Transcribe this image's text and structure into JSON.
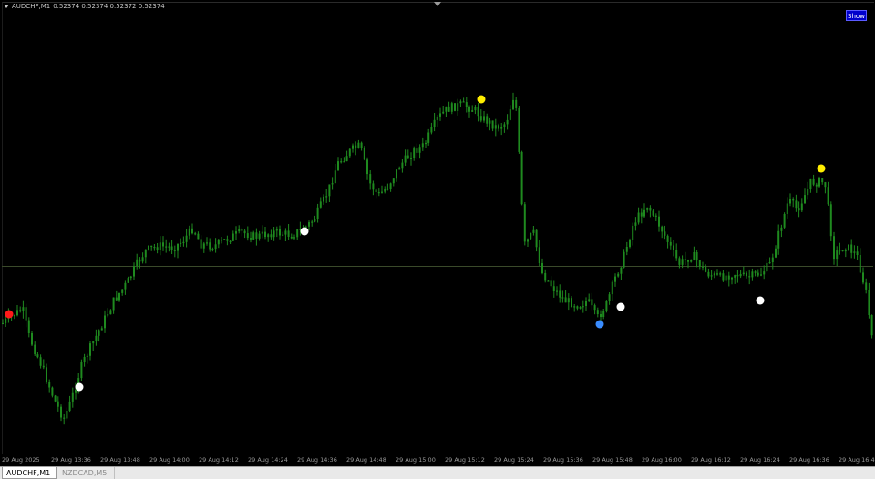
{
  "chart": {
    "symbol_header": "AUDCHF,M1",
    "ohlc": "0.52374  0.52374  0.52372  0.52374",
    "show_button": "Show",
    "colors": {
      "background": "#000000",
      "candle": "#1f8a1f",
      "level_line": "#3a4a2a",
      "marker_red": "#ff1a1a",
      "marker_white": "#ffffff",
      "marker_yellow": "#ffee00",
      "marker_blue": "#3a8cff"
    },
    "markers": [
      {
        "time_index": 1,
        "price": 0.5217,
        "color": "red"
      },
      {
        "time_index": 28,
        "price": 0.5215,
        "color": "white"
      },
      {
        "time_index": 110,
        "price": 0.5216,
        "color": "white"
      },
      {
        "time_index": 175,
        "price": 0.5217,
        "color": "yellow"
      },
      {
        "time_index": 218,
        "price": 0.5218,
        "color": "blue"
      },
      {
        "time_index": 226,
        "price": 0.5219,
        "color": "white"
      },
      {
        "time_index": 278,
        "price": 0.522,
        "color": "white"
      },
      {
        "time_index": 300,
        "price": 0.5221,
        "color": "yellow"
      }
    ],
    "time_labels": [
      "29 Aug 2025",
      "29 Aug 13:36",
      "29 Aug 13:48",
      "29 Aug 14:00",
      "29 Aug 14:12",
      "29 Aug 14:24",
      "29 Aug 14:36",
      "29 Aug 14:48",
      "29 Aug 15:00",
      "29 Aug 15:12",
      "29 Aug 15:24",
      "29 Aug 15:36",
      "29 Aug 15:48",
      "29 Aug 16:00",
      "29 Aug 16:12",
      "29 Aug 16:24",
      "29 Aug 16:36",
      "29 Aug 16:48"
    ]
  },
  "tabs": [
    {
      "label": "AUDCHF,M1",
      "active": true
    },
    {
      "label": "NZDCAD,M5",
      "active": false
    }
  ]
}
